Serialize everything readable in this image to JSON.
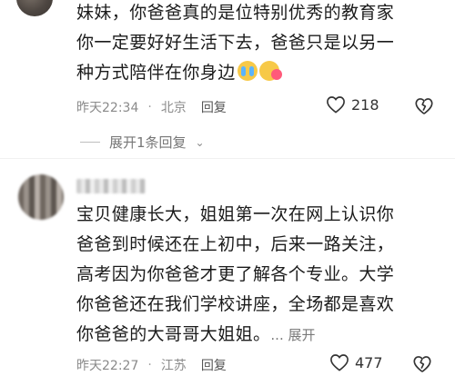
{
  "comment1": {
    "lines": [
      "妹妹，你爸爸真的是位特别优秀的教育家",
      "你一定要好好生活下去，爸爸只是以另一",
      "种方式陪伴在你身边"
    ],
    "time": "昨天22:34",
    "location": "北京",
    "reply_label": "回复",
    "likes": "218",
    "expand_label": "展开1条回复"
  },
  "comment2": {
    "lines": [
      "宝贝健康长大，姐姐第一次在网上认识你",
      "爸爸到时候还在上初中，后来一路关注，",
      "高考因为你爸爸才更了解各个专业。大学",
      "你爸爸还在我们学校讲座，全场都是喜欢",
      "你爸爸的大哥哥大姐姐。"
    ],
    "more_label": "... 展开",
    "time": "昨天22:27",
    "location": "江苏",
    "reply_label": "回复",
    "likes": "477"
  },
  "icons": [
    "crying-face-emoji",
    "hugging-face-emoji",
    "heart-icon",
    "dislike-icon",
    "chevron-down-icon"
  ],
  "colors": {
    "meta_text": "#8a8a8a",
    "body_text": "#1b1b1b",
    "background": "#ffffff"
  }
}
